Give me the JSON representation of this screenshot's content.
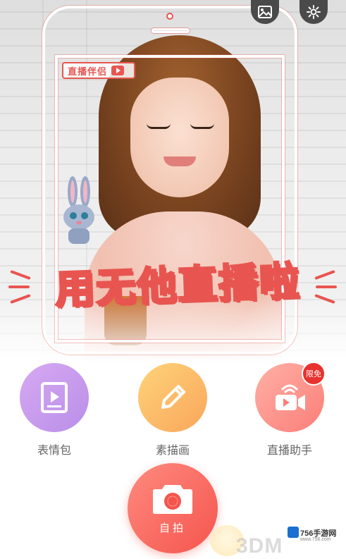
{
  "hero": {
    "tag_label": "直播伴侣",
    "slogan": "用无他直播啦"
  },
  "top_icons": [
    {
      "name": "gallery-icon"
    },
    {
      "name": "settings-icon"
    }
  ],
  "features": [
    {
      "label": "表情包"
    },
    {
      "label": "素描画"
    },
    {
      "label": "直播助手",
      "badge": "限免"
    }
  ],
  "selfie": {
    "label": "自拍"
  },
  "watermark": {
    "site_name": "756手游网",
    "url": "www.756.com",
    "brand": "3DM"
  },
  "colors": {
    "accent": "#e85550",
    "emoji_gradient": "#c79cee",
    "sketch_gradient": "#fbbc68",
    "live_gradient": "#fd9690",
    "label_text": "#666666"
  }
}
